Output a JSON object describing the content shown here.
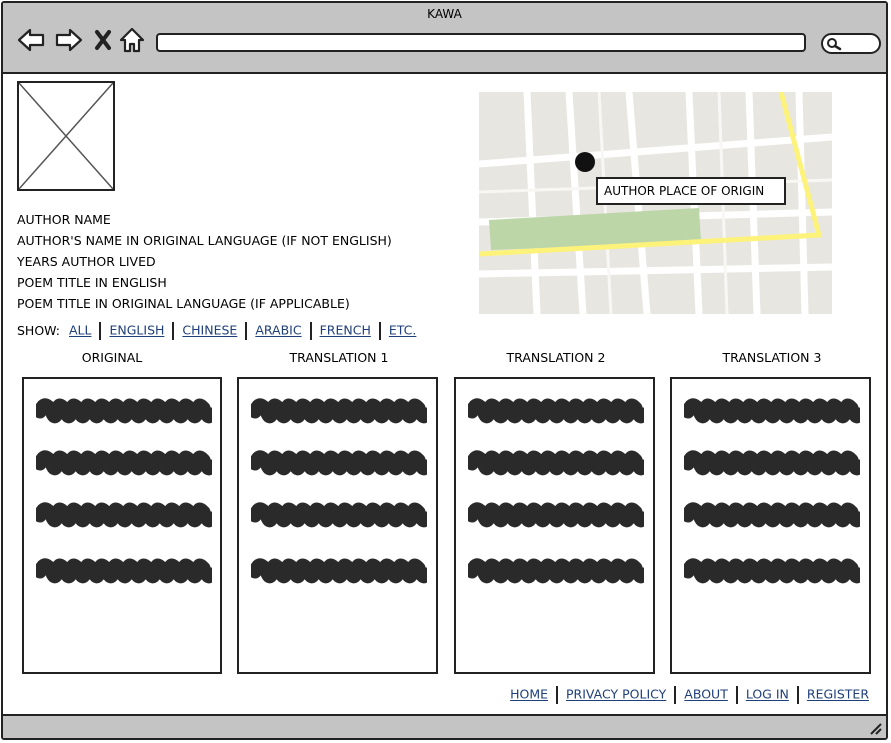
{
  "window": {
    "title": "KAWA"
  },
  "toolbar": {
    "back_icon": "arrow-left-icon",
    "forward_icon": "arrow-right-icon",
    "stop_icon": "close-icon",
    "home_icon": "home-icon",
    "url_value": "",
    "search_icon": "search-icon"
  },
  "author": {
    "name": "AUTHOR NAME",
    "name_original": "AUTHOR'S NAME IN ORIGINAL LANGUAGE (IF NOT ENGLISH)",
    "years": "YEARS AUTHOR LIVED",
    "poem_title_en": "POEM TITLE IN ENGLISH",
    "poem_title_original": "POEM TITLE IN ORIGINAL LANGUAGE (IF APPLICABLE)"
  },
  "map": {
    "callout": "AUTHOR PLACE OF ORIGIN",
    "marker_icon": "map-pin-icon"
  },
  "show": {
    "label": "SHOW:",
    "links": [
      "ALL",
      "ENGLISH",
      "CHINESE",
      "ARABIC",
      "FRENCH",
      "ETC."
    ]
  },
  "columns": [
    "ORIGINAL",
    "TRANSLATION 1",
    "TRANSLATION 2",
    "TRANSLATION 3"
  ],
  "footer": {
    "links": [
      "HOME",
      "PRIVACY POLICY",
      "ABOUT",
      "LOG IN",
      "REGISTER"
    ]
  },
  "colors": {
    "chrome": "#c4c4c4",
    "link": "#1f3f7a",
    "map_bg": "#e8e6e1",
    "map_road_major": "#fdf27a",
    "map_park": "#bcd6a8"
  }
}
